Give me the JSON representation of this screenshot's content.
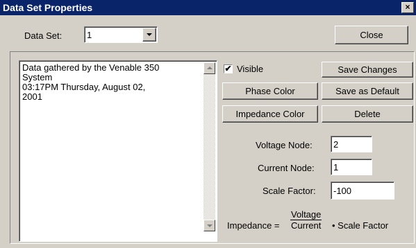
{
  "window": {
    "title": "Data Set Properties",
    "close_glyph": "×"
  },
  "dataset": {
    "label": "Data Set:",
    "selected_value": "1"
  },
  "buttons": {
    "close": "Close",
    "save_changes": "Save Changes",
    "phase_color": "Phase Color",
    "save_as_default": "Save as Default",
    "impedance_color": "Impedance Color",
    "delete": "Delete"
  },
  "notes": {
    "text": "Data gathered by the Venable 350\nSystem\n03:17PM Thursday, August 02,\n2001"
  },
  "visible": {
    "label": "Visible",
    "checked": true,
    "check_glyph": "✔"
  },
  "fields": {
    "voltage_node_label": "Voltage Node:",
    "voltage_node_value": "2",
    "current_node_label": "Current Node:",
    "current_node_value": "1",
    "scale_factor_label": "Scale Factor:",
    "scale_factor_value": "-100"
  },
  "formula": {
    "lhs": "Impedance =",
    "numerator": "Voltage",
    "denominator": "Current",
    "rhs": "• Scale Factor"
  },
  "colors": {
    "titlebar": "#0a246a",
    "face": "#d4d0c8"
  }
}
